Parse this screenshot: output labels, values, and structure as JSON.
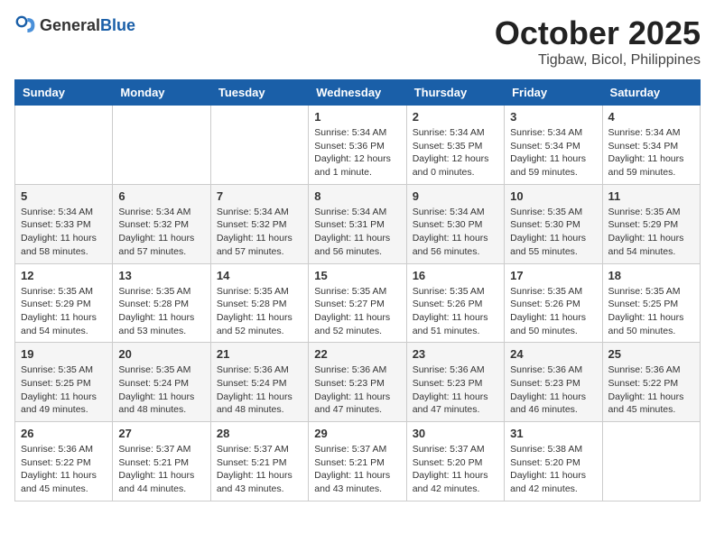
{
  "header": {
    "logo_general": "General",
    "logo_blue": "Blue",
    "month": "October 2025",
    "location": "Tigbaw, Bicol, Philippines"
  },
  "weekdays": [
    "Sunday",
    "Monday",
    "Tuesday",
    "Wednesday",
    "Thursday",
    "Friday",
    "Saturday"
  ],
  "weeks": [
    [
      {
        "day": "",
        "info": ""
      },
      {
        "day": "",
        "info": ""
      },
      {
        "day": "",
        "info": ""
      },
      {
        "day": "1",
        "info": "Sunrise: 5:34 AM\nSunset: 5:36 PM\nDaylight: 12 hours\nand 1 minute."
      },
      {
        "day": "2",
        "info": "Sunrise: 5:34 AM\nSunset: 5:35 PM\nDaylight: 12 hours\nand 0 minutes."
      },
      {
        "day": "3",
        "info": "Sunrise: 5:34 AM\nSunset: 5:34 PM\nDaylight: 11 hours\nand 59 minutes."
      },
      {
        "day": "4",
        "info": "Sunrise: 5:34 AM\nSunset: 5:34 PM\nDaylight: 11 hours\nand 59 minutes."
      }
    ],
    [
      {
        "day": "5",
        "info": "Sunrise: 5:34 AM\nSunset: 5:33 PM\nDaylight: 11 hours\nand 58 minutes."
      },
      {
        "day": "6",
        "info": "Sunrise: 5:34 AM\nSunset: 5:32 PM\nDaylight: 11 hours\nand 57 minutes."
      },
      {
        "day": "7",
        "info": "Sunrise: 5:34 AM\nSunset: 5:32 PM\nDaylight: 11 hours\nand 57 minutes."
      },
      {
        "day": "8",
        "info": "Sunrise: 5:34 AM\nSunset: 5:31 PM\nDaylight: 11 hours\nand 56 minutes."
      },
      {
        "day": "9",
        "info": "Sunrise: 5:34 AM\nSunset: 5:30 PM\nDaylight: 11 hours\nand 56 minutes."
      },
      {
        "day": "10",
        "info": "Sunrise: 5:35 AM\nSunset: 5:30 PM\nDaylight: 11 hours\nand 55 minutes."
      },
      {
        "day": "11",
        "info": "Sunrise: 5:35 AM\nSunset: 5:29 PM\nDaylight: 11 hours\nand 54 minutes."
      }
    ],
    [
      {
        "day": "12",
        "info": "Sunrise: 5:35 AM\nSunset: 5:29 PM\nDaylight: 11 hours\nand 54 minutes."
      },
      {
        "day": "13",
        "info": "Sunrise: 5:35 AM\nSunset: 5:28 PM\nDaylight: 11 hours\nand 53 minutes."
      },
      {
        "day": "14",
        "info": "Sunrise: 5:35 AM\nSunset: 5:28 PM\nDaylight: 11 hours\nand 52 minutes."
      },
      {
        "day": "15",
        "info": "Sunrise: 5:35 AM\nSunset: 5:27 PM\nDaylight: 11 hours\nand 52 minutes."
      },
      {
        "day": "16",
        "info": "Sunrise: 5:35 AM\nSunset: 5:26 PM\nDaylight: 11 hours\nand 51 minutes."
      },
      {
        "day": "17",
        "info": "Sunrise: 5:35 AM\nSunset: 5:26 PM\nDaylight: 11 hours\nand 50 minutes."
      },
      {
        "day": "18",
        "info": "Sunrise: 5:35 AM\nSunset: 5:25 PM\nDaylight: 11 hours\nand 50 minutes."
      }
    ],
    [
      {
        "day": "19",
        "info": "Sunrise: 5:35 AM\nSunset: 5:25 PM\nDaylight: 11 hours\nand 49 minutes."
      },
      {
        "day": "20",
        "info": "Sunrise: 5:35 AM\nSunset: 5:24 PM\nDaylight: 11 hours\nand 48 minutes."
      },
      {
        "day": "21",
        "info": "Sunrise: 5:36 AM\nSunset: 5:24 PM\nDaylight: 11 hours\nand 48 minutes."
      },
      {
        "day": "22",
        "info": "Sunrise: 5:36 AM\nSunset: 5:23 PM\nDaylight: 11 hours\nand 47 minutes."
      },
      {
        "day": "23",
        "info": "Sunrise: 5:36 AM\nSunset: 5:23 PM\nDaylight: 11 hours\nand 47 minutes."
      },
      {
        "day": "24",
        "info": "Sunrise: 5:36 AM\nSunset: 5:23 PM\nDaylight: 11 hours\nand 46 minutes."
      },
      {
        "day": "25",
        "info": "Sunrise: 5:36 AM\nSunset: 5:22 PM\nDaylight: 11 hours\nand 45 minutes."
      }
    ],
    [
      {
        "day": "26",
        "info": "Sunrise: 5:36 AM\nSunset: 5:22 PM\nDaylight: 11 hours\nand 45 minutes."
      },
      {
        "day": "27",
        "info": "Sunrise: 5:37 AM\nSunset: 5:21 PM\nDaylight: 11 hours\nand 44 minutes."
      },
      {
        "day": "28",
        "info": "Sunrise: 5:37 AM\nSunset: 5:21 PM\nDaylight: 11 hours\nand 43 minutes."
      },
      {
        "day": "29",
        "info": "Sunrise: 5:37 AM\nSunset: 5:21 PM\nDaylight: 11 hours\nand 43 minutes."
      },
      {
        "day": "30",
        "info": "Sunrise: 5:37 AM\nSunset: 5:20 PM\nDaylight: 11 hours\nand 42 minutes."
      },
      {
        "day": "31",
        "info": "Sunrise: 5:38 AM\nSunset: 5:20 PM\nDaylight: 11 hours\nand 42 minutes."
      },
      {
        "day": "",
        "info": ""
      }
    ]
  ]
}
